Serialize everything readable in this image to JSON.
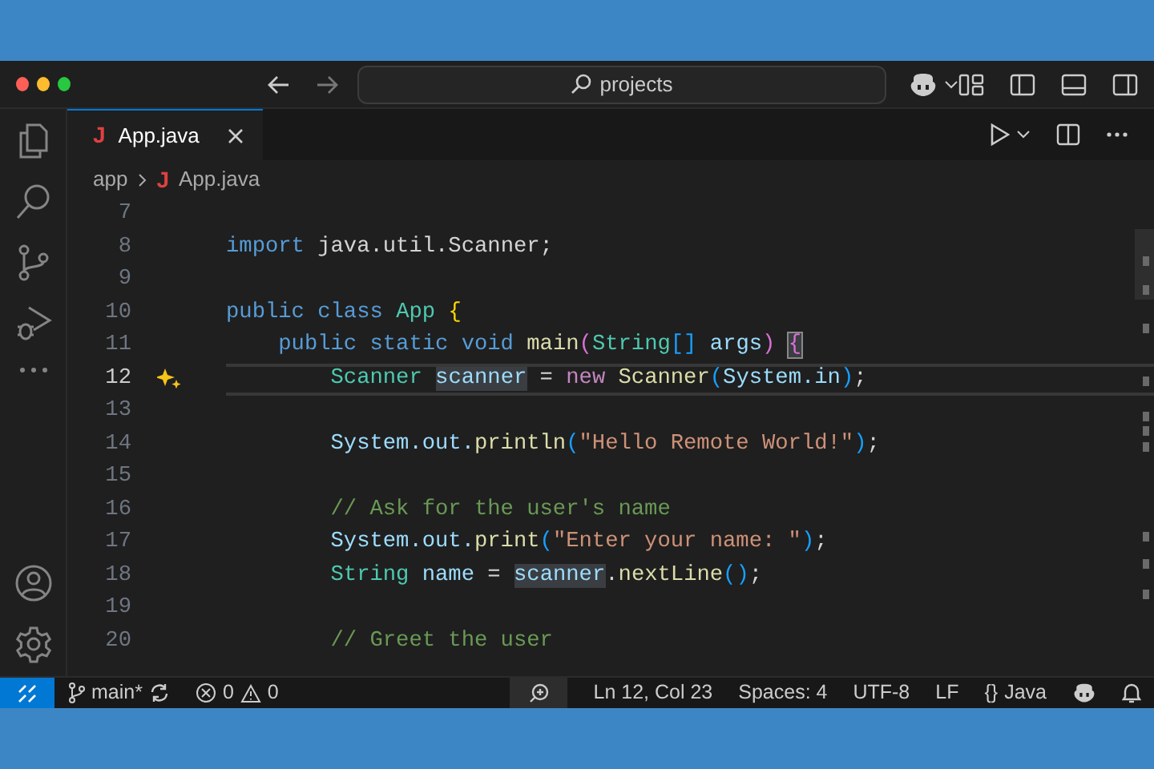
{
  "title_bar": {
    "search": "projects"
  },
  "tabs": [
    {
      "icon": "J",
      "label": "App.java",
      "selected": true
    }
  ],
  "breadcrumbs": [
    {
      "label": "app"
    },
    {
      "icon": "J",
      "label": "App.java"
    }
  ],
  "editor": {
    "lines": [
      {
        "n": "7",
        "current": false
      },
      {
        "n": "8",
        "current": false,
        "tokens": [
          {
            "t": "import",
            "kind": "kw"
          },
          {
            "t": " java.util.Scanner;",
            "kind": "plain"
          }
        ]
      },
      {
        "n": "9",
        "current": false
      },
      {
        "n": "10",
        "current": false,
        "tokens": [
          {
            "t": "public class",
            "kind": "kw"
          },
          {
            "t": " App",
            "kind": "type"
          },
          {
            "t": " {",
            "kind": "b1"
          }
        ],
        "children": [
          {
            "n": "11",
            "current": false,
            "tokens": [
              {
                "t": "public static void",
                "kind": "kw"
              },
              {
                "t": " main",
                "kind": "fn"
              },
              {
                "t": "(",
                "kind": "b2"
              },
              {
                "t": "String",
                "kind": "type"
              },
              {
                "t": "[]",
                "kind": "b3"
              },
              {
                "t": " args",
                "kind": "var"
              },
              {
                "t": ")",
                "kind": "b2"
              },
              {
                "t": " {",
                "kind": "b2",
                "highlight": true
              }
            ],
            "children": [
              {
                "n": "12",
                "current": true,
                "tokens": [
                  {
                    "t": "Scanner",
                    "kind": "type"
                  },
                  {
                    "t": " scanner",
                    "kind": "var",
                    "highlight": true
                  },
                  {
                    "t": " =",
                    "kind": "plain"
                  },
                  {
                    "t": " new",
                    "kind": "ctl"
                  },
                  {
                    "t": " Scanner",
                    "kind": "fn"
                  },
                  {
                    "t": "(",
                    "kind": "b3"
                  },
                  {
                    "t": "System.in",
                    "kind": "var"
                  },
                  {
                    "t": ")",
                    "kind": "b3"
                  },
                  {
                    "t": ";",
                    "kind": "plain"
                  }
                ]
              },
              {
                "n": "13",
                "current": false
              },
              {
                "n": "14",
                "current": false,
                "tokens": [
                  {
                    "t": "System.out.",
                    "kind": "var"
                  },
                  {
                    "t": "println",
                    "kind": "fn"
                  },
                  {
                    "t": "(",
                    "kind": "b3"
                  },
                  {
                    "t": "\"Hello Remote World!\"",
                    "kind": "str"
                  },
                  {
                    "t": ")",
                    "kind": "b3"
                  },
                  {
                    "t": ";",
                    "kind": "plain"
                  }
                ]
              },
              {
                "n": "15",
                "current": false
              },
              {
                "n": "16",
                "current": false,
                "tokens": [
                  {
                    "t": "// Ask for the user's name",
                    "kind": "cmt"
                  }
                ]
              },
              {
                "n": "17",
                "current": false,
                "tokens": [
                  {
                    "t": "System.out.",
                    "kind": "var"
                  },
                  {
                    "t": "print",
                    "kind": "fn"
                  },
                  {
                    "t": "(",
                    "kind": "b3"
                  },
                  {
                    "t": "\"Enter your name: \"",
                    "kind": "str"
                  },
                  {
                    "t": ")",
                    "kind": "b3"
                  },
                  {
                    "t": ";",
                    "kind": "plain"
                  }
                ]
              },
              {
                "n": "18",
                "current": false,
                "tokens": [
                  {
                    "t": "String",
                    "kind": "type"
                  },
                  {
                    "t": " name",
                    "kind": "var"
                  },
                  {
                    "t": " =",
                    "kind": "plain"
                  },
                  {
                    "t": " scanner",
                    "kind": "var",
                    "highlight": true
                  },
                  {
                    "t": ".",
                    "kind": "plain"
                  },
                  {
                    "t": "nextLine",
                    "kind": "fn"
                  },
                  {
                    "t": "()",
                    "kind": "b3"
                  },
                  {
                    "t": ";",
                    "kind": "plain"
                  }
                ]
              },
              {
                "n": "19",
                "current": false
              },
              {
                "n": "20",
                "current": false,
                "tokens": [
                  {
                    "t": "// Greet the user",
                    "kind": "cmt"
                  }
                ]
              }
            ]
          }
        ]
      }
    ]
  },
  "status_bar": {
    "branch": "main*",
    "errors": "0",
    "warnings": "0",
    "position": "Ln 12, Col 23",
    "spaces": "Spaces: 4",
    "encoding": "UTF-8",
    "eol": "LF",
    "language_icon": "{}",
    "language": "Java"
  }
}
